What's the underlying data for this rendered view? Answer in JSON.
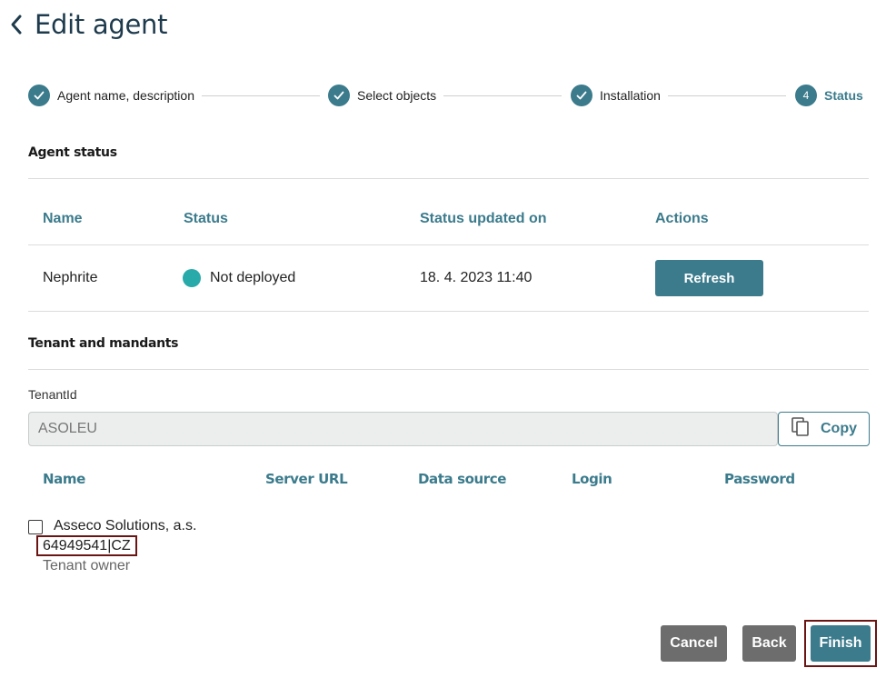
{
  "header": {
    "title": "Edit agent",
    "back_icon": "chevron-left-icon"
  },
  "stepper": {
    "steps": [
      {
        "label": "Agent name, description",
        "state": "done"
      },
      {
        "label": "Select objects",
        "state": "done"
      },
      {
        "label": "Installation",
        "state": "done"
      },
      {
        "label": "Status",
        "number": "4",
        "state": "active"
      }
    ]
  },
  "agent_status": {
    "title": "Agent status",
    "columns": [
      "Name",
      "Status",
      "Status updated on",
      "Actions"
    ],
    "row": {
      "name": "Nephrite",
      "status": "Not deployed",
      "status_color": "#27aaa9",
      "updated_on": "18. 4. 2023 11:40",
      "action_label": "Refresh"
    }
  },
  "tenant": {
    "title": "Tenant and mandants",
    "field_label": "TenantId",
    "tenant_id_value": "ASOLEU",
    "copy_label": "Copy",
    "columns": [
      "Name",
      "Server URL",
      "Data source",
      "Login",
      "Password"
    ],
    "mandants": [
      {
        "name": "Asseco Solutions, a.s.",
        "id": "64949541|CZ",
        "role": "Tenant owner",
        "checked": false
      }
    ]
  },
  "footer": {
    "cancel_label": "Cancel",
    "back_label": "Back",
    "finish_label": "Finish"
  },
  "colors": {
    "accent": "#3b7b8c",
    "title": "#1e3b4d",
    "gray_button": "#6d6d6d",
    "highlight_border": "#6b1414"
  }
}
